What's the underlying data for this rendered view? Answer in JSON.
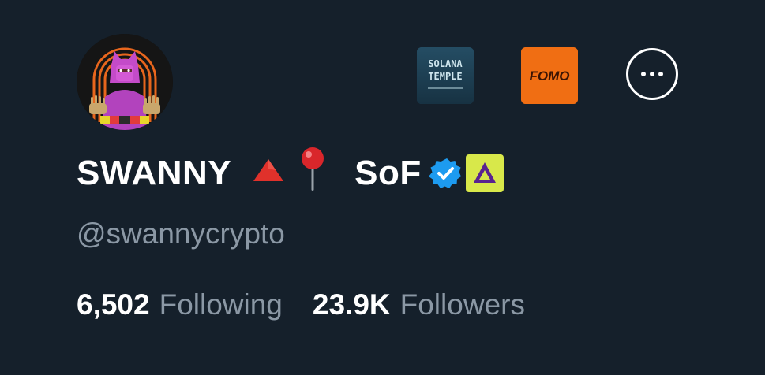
{
  "profile": {
    "display_name": "SWANNY",
    "name_suffix": "SoF",
    "handle": "@swannycrypto",
    "verified": true,
    "emojis": [
      "red-triangle",
      "round-pushpin"
    ]
  },
  "affiliates": [
    {
      "name": "solana-temple-badge",
      "line1": "SOLANA",
      "line2": "TEMPLE"
    },
    {
      "name": "fomo-badge",
      "text": "FOMO"
    }
  ],
  "stats": {
    "following_count": "6,502",
    "following_label": "Following",
    "followers_count": "23.9K",
    "followers_label": "Followers"
  },
  "colors": {
    "background": "#15202b",
    "primary_text": "#ffffff",
    "secondary_text": "#8b98a5",
    "verified_blue": "#1d9bf0",
    "fomo_orange": "#f06e13",
    "badge_yellow": "#d8e84a"
  }
}
